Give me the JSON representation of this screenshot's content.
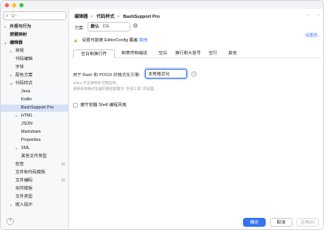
{
  "sidebar": {
    "search_placeholder": "Q~",
    "items": [
      {
        "label": "外观与行为",
        "chevron": ">",
        "bold": true
      },
      {
        "label": "按键映射",
        "bold": true
      },
      {
        "label": "编辑器",
        "chevron": "∨",
        "bold": true
      },
      {
        "label": "常规",
        "chevron": ">"
      },
      {
        "label": "代码编辑"
      },
      {
        "label": "字体"
      },
      {
        "label": "配色方案",
        "chevron": ">"
      },
      {
        "label": "代码样式",
        "chevron": "∨"
      },
      {
        "label": "Java"
      },
      {
        "label": "Kotlin"
      },
      {
        "label": "BashSupport Pro",
        "selected": true
      },
      {
        "label": "HTML",
        "chevron": ">"
      },
      {
        "label": "JSON"
      },
      {
        "label": "Markdown"
      },
      {
        "label": "Properties"
      },
      {
        "label": "XML",
        "chevron": ">"
      },
      {
        "label": "其他文件类型"
      },
      {
        "label": "检查",
        "badge": "⊟"
      },
      {
        "label": "文件和代码模板"
      },
      {
        "label": "文件编码",
        "badge": "⊟"
      },
      {
        "label": "实时模板"
      },
      {
        "label": "文件类型"
      },
      {
        "label": "嵌入提示",
        "chevron": ">"
      }
    ],
    "help": "?"
  },
  "header": {
    "breadcrumb": [
      "编辑器",
      "代码样式",
      "BashSupport Pro"
    ],
    "separator": ">",
    "back_icon": "←",
    "forward_icon": "→"
  },
  "scheme": {
    "label": "方案:",
    "value": "默认",
    "suffix": "IDE",
    "set_from": "设置自..."
  },
  "warning": {
    "text": "设置可能被 EditorConfig 覆盖",
    "link": "禁用"
  },
  "tabs": [
    "空白和换行符",
    "制表符和缩进",
    "空白",
    "换行和大括号",
    "空行",
    "其他"
  ],
  "option": {
    "label": "用于 Bash 和 POSIX 的格式化引擎:",
    "value": "本地格式化",
    "hint_lines": [
      "shfmt 不支持所有可用选项。",
      "请将本地格式化器的路径配置为 “外部工具” 的设置。"
    ]
  },
  "checkbox": {
    "label": "遵守容器 Shell 编程风格",
    "checked": false
  },
  "buttons": {
    "ok": "确定",
    "cancel": "取消",
    "apply": "应用(A)"
  },
  "colors": {
    "accent": "#3574f0",
    "selection": "#d5e1f7",
    "warning": "#f0a732"
  }
}
